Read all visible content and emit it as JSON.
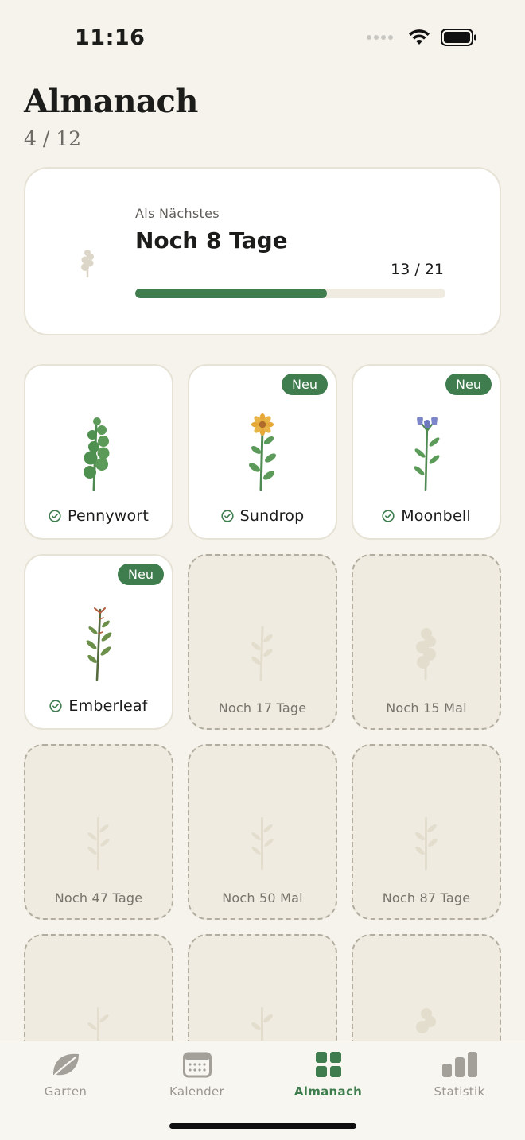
{
  "status_bar": {
    "time": "11:16"
  },
  "header": {
    "title": "Almanach",
    "count": "4 / 12"
  },
  "next_card": {
    "label": "Als Nächstes",
    "title": "Noch 8 Tage",
    "ratio": "13 / 21",
    "progress": 0.619
  },
  "tiles": [
    {
      "kind": "unlocked",
      "name": "Pennywort",
      "badge": "",
      "icon": "pennywort-plant-icon"
    },
    {
      "kind": "unlocked",
      "name": "Sundrop",
      "badge": "Neu",
      "icon": "sundrop-flower-icon"
    },
    {
      "kind": "unlocked",
      "name": "Moonbell",
      "badge": "Neu",
      "icon": "moonbell-flower-icon"
    },
    {
      "kind": "unlocked",
      "name": "Emberleaf",
      "badge": "Neu",
      "icon": "emberleaf-plant-icon"
    },
    {
      "kind": "locked",
      "text": "Noch 17 Tage",
      "icon": "locked-sprig-icon"
    },
    {
      "kind": "locked",
      "text": "Noch 15 Mal",
      "icon": "locked-leaf-icon"
    },
    {
      "kind": "locked",
      "text": "Noch 47 Tage",
      "icon": "locked-sprig-icon"
    },
    {
      "kind": "locked",
      "text": "Noch 50 Mal",
      "icon": "locked-sprig-icon"
    },
    {
      "kind": "locked",
      "text": "Noch 87 Tage",
      "icon": "locked-sprig-icon"
    },
    {
      "kind": "locked",
      "text": "",
      "icon": "locked-sprig-icon"
    },
    {
      "kind": "locked",
      "text": "",
      "icon": "locked-sprig-icon"
    },
    {
      "kind": "locked",
      "text": "",
      "icon": "locked-leaf-icon"
    }
  ],
  "tab_bar": {
    "items": [
      {
        "label": "Garten",
        "icon": "leaf-icon"
      },
      {
        "label": "Kalender",
        "icon": "calendar-icon"
      },
      {
        "label": "Almanach",
        "icon": "grid-icon",
        "active": true
      },
      {
        "label": "Statistik",
        "icon": "bar-chart-icon"
      }
    ]
  },
  "colors": {
    "accent": "#3f7d4e",
    "background": "#f6f3ec",
    "locked_tile": "#efebe0"
  }
}
